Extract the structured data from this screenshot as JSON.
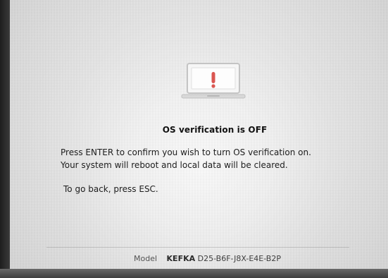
{
  "screen": {
    "title": "OS verification is OFF",
    "message_line_1": "Press ENTER to confirm you wish to turn OS verification on.",
    "message_line_2": "Your system will reboot and local data will be cleared.",
    "back_instruction": "To go back, press ESC.",
    "model_label": "Model",
    "model_code": "KEFKA",
    "model_value": "D25-B6F-J8X-E4E-B2P"
  },
  "icons": {
    "warning_laptop": "warning-laptop-icon"
  },
  "colors": {
    "background": "#e9e9e9",
    "text_primary": "#1d1d1d",
    "text_secondary": "#535353",
    "accent": "#d9534f",
    "icon_outline": "#bdbdbd"
  }
}
